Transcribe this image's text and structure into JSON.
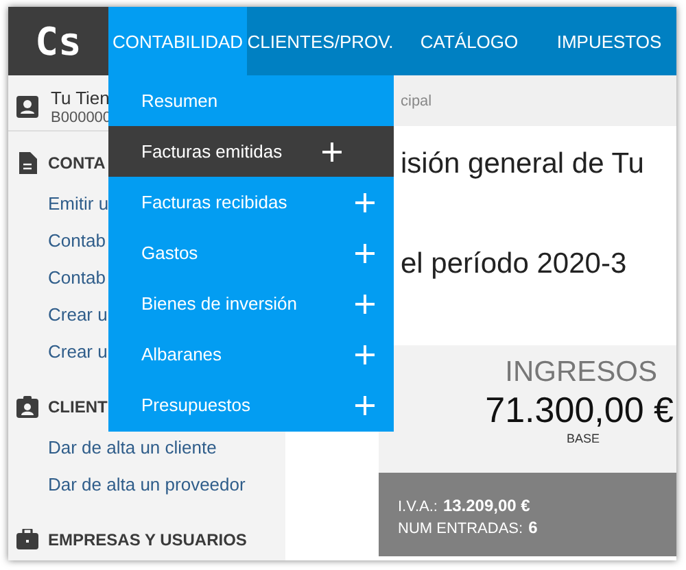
{
  "logo": "Cs",
  "nav": [
    {
      "label": "CONTABILIDAD",
      "selected": true
    },
    {
      "label": "CLIENTES/PROV.",
      "selected": false
    },
    {
      "label": "CATÁLOGO",
      "selected": false
    },
    {
      "label": "IMPUESTOS",
      "selected": false
    }
  ],
  "dropdown": [
    {
      "label": "Resumen",
      "selected": false,
      "expandable": false
    },
    {
      "label": "Facturas emitidas",
      "selected": true,
      "expandable": true
    },
    {
      "label": "Facturas recibidas",
      "selected": false,
      "expandable": true
    },
    {
      "label": "Gastos",
      "selected": false,
      "expandable": true
    },
    {
      "label": "Bienes de inversión",
      "selected": false,
      "expandable": true
    },
    {
      "label": "Albaranes",
      "selected": false,
      "expandable": true
    },
    {
      "label": "Presupuestos",
      "selected": false,
      "expandable": true
    }
  ],
  "account": {
    "name": "Tu Tien",
    "id": "B000000"
  },
  "sidebar": [
    {
      "title": "CONTA",
      "links": [
        "Emitir u",
        "Contab",
        "Contab",
        "Crear u",
        "Crear u"
      ]
    },
    {
      "title": "CLIENT",
      "links": [
        "Dar de alta un cliente",
        "Dar de alta un proveedor"
      ]
    },
    {
      "title": "EMPRESAS Y USUARIOS"
    }
  ],
  "breadcrumb": "cipal",
  "heading": [
    "isión general de Tu",
    "el período 2020-3"
  ],
  "card": {
    "title": "INGRESOS",
    "value": "71.300,00 €",
    "value_label": "BASE",
    "details": [
      {
        "label": "I.V.A.:",
        "value": "13.209,00 €"
      },
      {
        "label": "NUM ENTRADAS:",
        "value": "6"
      }
    ]
  }
}
